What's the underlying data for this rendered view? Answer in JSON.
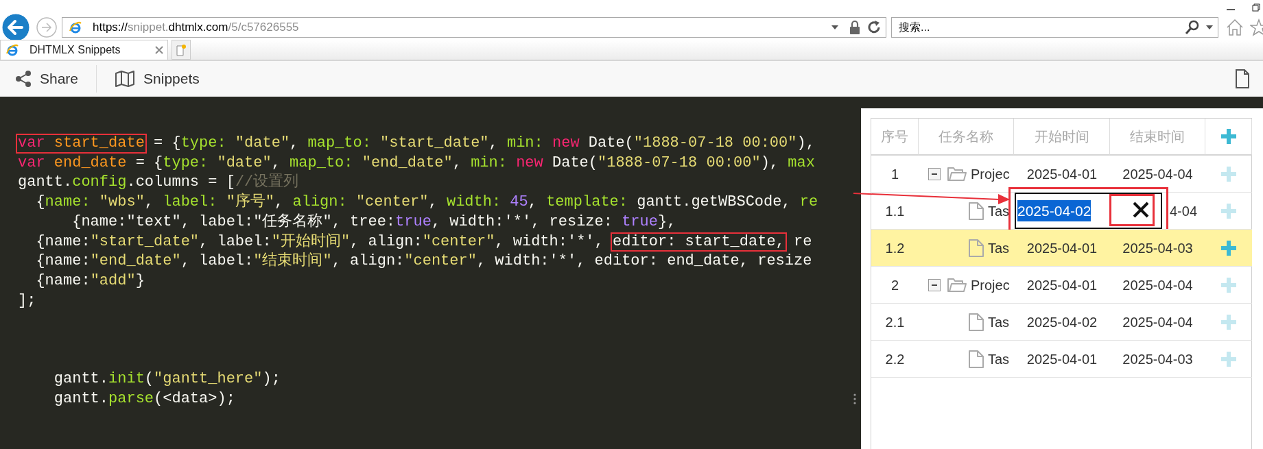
{
  "browser": {
    "url": [
      {
        "text": "https://",
        "strong": true
      },
      {
        "text": "snippet.",
        "strong": false
      },
      {
        "text": "dhtmlx.com",
        "strong": true
      },
      {
        "text": "/5/c57626555",
        "strong": false
      }
    ],
    "search": {
      "placeholder": "搜索..."
    },
    "tabs": [
      {
        "title": "DHTMLX Snippets",
        "selected": true
      }
    ]
  },
  "toolbar": {
    "buttons": [
      {
        "label": "Share",
        "kind": "share"
      },
      {
        "label": "Snippets",
        "kind": "map"
      }
    ]
  },
  "code": {
    "blocks": [
      [
        {
          "tokens": [
            {
              "kind": "annotation",
              "tokens": [
                {
                  "text": "var ",
                  "kind": "keyword"
                },
                {
                  "text": "start_date",
                  "kind": "variable"
                }
              ]
            },
            {
              "text": " = {",
              "kind": "plain"
            },
            {
              "text": "type:",
              "kind": "property"
            },
            {
              "text": " \"date\"",
              "kind": "string"
            },
            {
              "text": ", ",
              "kind": "plain"
            },
            {
              "text": "map_to:",
              "kind": "property"
            },
            {
              "text": " \"start_date\"",
              "kind": "string"
            },
            {
              "text": ", ",
              "kind": "plain"
            },
            {
              "text": "min:",
              "kind": "property"
            },
            {
              "text": " new",
              "kind": "keyword"
            },
            {
              "text": " Date(",
              "kind": "plain"
            },
            {
              "text": "\"1888-07-18 00:00\"",
              "kind": "string"
            },
            {
              "text": "),",
              "kind": "plain"
            }
          ]
        },
        {
          "tokens": [
            {
              "text": "var ",
              "kind": "keyword"
            },
            {
              "text": "end_date",
              "kind": "variable"
            },
            {
              "text": " = {",
              "kind": "plain"
            },
            {
              "text": "type:",
              "kind": "property"
            },
            {
              "text": " \"date\"",
              "kind": "string"
            },
            {
              "text": ", ",
              "kind": "plain"
            },
            {
              "text": "map_to:",
              "kind": "property"
            },
            {
              "text": " \"end_date\"",
              "kind": "string"
            },
            {
              "text": ", ",
              "kind": "plain"
            },
            {
              "text": "min:",
              "kind": "property"
            },
            {
              "text": " new",
              "kind": "keyword"
            },
            {
              "text": " Date(",
              "kind": "plain"
            },
            {
              "text": "\"1888-07-18 00:00\"",
              "kind": "string"
            },
            {
              "text": "), ",
              "kind": "plain"
            },
            {
              "text": "max",
              "kind": "property"
            }
          ]
        },
        {
          "tokens": [
            {
              "text": "gantt.",
              "kind": "plain"
            },
            {
              "text": "config",
              "kind": "property"
            },
            {
              "text": ".columns = [",
              "kind": "plain"
            },
            {
              "text": "//设置列",
              "kind": "comment"
            }
          ]
        },
        {
          "tokens": [
            {
              "text": "  {",
              "kind": "plain"
            },
            {
              "text": "name:",
              "kind": "property"
            },
            {
              "text": " \"wbs\"",
              "kind": "string"
            },
            {
              "text": ", ",
              "kind": "plain"
            },
            {
              "text": "label:",
              "kind": "property"
            },
            {
              "text": " \"序号\"",
              "kind": "string"
            },
            {
              "text": ", ",
              "kind": "plain"
            },
            {
              "text": "align:",
              "kind": "property"
            },
            {
              "text": " \"center\"",
              "kind": "string"
            },
            {
              "text": ", ",
              "kind": "plain"
            },
            {
              "text": "width:",
              "kind": "property"
            },
            {
              "text": " 45",
              "kind": "number"
            },
            {
              "text": ", ",
              "kind": "plain"
            },
            {
              "text": "template:",
              "kind": "property"
            },
            {
              "text": " gantt.getWBSCode, ",
              "kind": "plain"
            },
            {
              "text": "re",
              "kind": "property"
            }
          ]
        },
        {
          "tokens": [
            {
              "text": "      {name:\"text\", label:\"任务名称\", tree:",
              "kind": "plain"
            },
            {
              "text": "true",
              "kind": "number"
            },
            {
              "text": ", width:'*', resize: ",
              "kind": "plain"
            },
            {
              "text": "true",
              "kind": "number"
            },
            {
              "text": "},",
              "kind": "plain"
            }
          ]
        },
        {
          "tokens": [
            {
              "text": "  {name:",
              "kind": "plain"
            },
            {
              "text": "\"start_date\"",
              "kind": "string"
            },
            {
              "text": ", label:",
              "kind": "plain"
            },
            {
              "text": "\"开始时间\"",
              "kind": "string"
            },
            {
              "text": ", align:",
              "kind": "plain"
            },
            {
              "text": "\"center\"",
              "kind": "string"
            },
            {
              "text": ", width:'*', ",
              "kind": "plain"
            },
            {
              "kind": "annotation",
              "tokens": [
                {
                  "text": "editor: start_date,",
                  "kind": "plain"
                }
              ]
            },
            {
              "text": " re",
              "kind": "plain"
            }
          ]
        },
        {
          "tokens": [
            {
              "text": "  {name:",
              "kind": "plain"
            },
            {
              "text": "\"end_date\"",
              "kind": "string"
            },
            {
              "text": ", label:",
              "kind": "plain"
            },
            {
              "text": "\"结束时间\"",
              "kind": "string"
            },
            {
              "text": ", align:",
              "kind": "plain"
            },
            {
              "text": "\"center\"",
              "kind": "string"
            },
            {
              "text": ", width:'*', editor: end_date, resize",
              "kind": "plain"
            }
          ]
        },
        {
          "tokens": [
            {
              "text": "  {name:",
              "kind": "plain"
            },
            {
              "text": "\"add\"",
              "kind": "string"
            },
            {
              "text": "}",
              "kind": "plain"
            }
          ]
        },
        {
          "tokens": [
            {
              "text": "];",
              "kind": "plain"
            }
          ]
        }
      ],
      [
        {
          "tokens": [
            {
              "text": "    gantt.",
              "kind": "plain"
            },
            {
              "text": "init",
              "kind": "property"
            },
            {
              "text": "(",
              "kind": "plain"
            },
            {
              "text": "\"gantt_here\"",
              "kind": "string"
            },
            {
              "text": ");",
              "kind": "plain"
            }
          ]
        },
        {
          "tokens": [
            {
              "text": "    gantt.",
              "kind": "plain"
            },
            {
              "text": "parse",
              "kind": "property"
            },
            {
              "text": "(<data>);",
              "kind": "plain"
            }
          ]
        }
      ]
    ]
  },
  "gantt": {
    "columns": [
      {
        "kind": "text",
        "label": "序号"
      },
      {
        "kind": "text",
        "label": "任务名称"
      },
      {
        "kind": "text",
        "label": "开始时间"
      },
      {
        "kind": "text",
        "label": "结束时间"
      },
      {
        "kind": "add"
      }
    ],
    "rows": [
      {
        "wbs": "1",
        "kind": "project",
        "expanded": true,
        "text": "Projec",
        "start": "2025-04-01",
        "end": "2025-04-04",
        "selected": false,
        "children": [
          {
            "wbs": "1.1",
            "kind": "task",
            "text": "Tas",
            "end": "4-04",
            "selected": false,
            "editor": {
              "value": "2025-04-02",
              "text_selected": true,
              "annotated": true,
              "clear_annotated": true,
              "arrow": true
            }
          },
          {
            "wbs": "1.2",
            "kind": "task",
            "text": "Tas",
            "start": "2025-04-01",
            "end": "2025-04-03",
            "selected": true
          }
        ]
      },
      {
        "wbs": "2",
        "kind": "project",
        "expanded": true,
        "text": "Projec",
        "start": "2025-04-01",
        "end": "2025-04-04",
        "selected": false,
        "children": [
          {
            "wbs": "2.1",
            "kind": "task",
            "text": "Tas",
            "start": "2025-04-02",
            "end": "2025-04-04",
            "selected": false
          },
          {
            "wbs": "2.2",
            "kind": "task",
            "text": "Tas",
            "start": "2025-04-01",
            "end": "2025-04-03",
            "selected": false
          }
        ]
      }
    ]
  }
}
